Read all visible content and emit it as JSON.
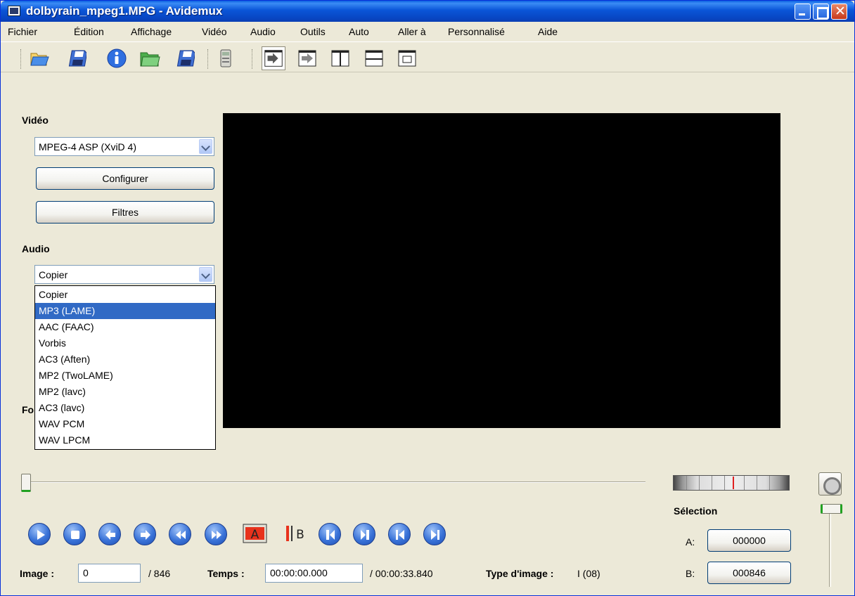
{
  "window": {
    "title": "dolbyrain_mpeg1.MPG - Avidemux"
  },
  "menu": [
    "Fichier",
    "Édition",
    "Affichage",
    "Vidéo",
    "Audio",
    "Outils",
    "Auto",
    "Aller à",
    "Personnalisé",
    "Aide"
  ],
  "toolbar": {
    "icons": [
      "open-icon",
      "save-icon",
      "info-icon",
      "open-folder-icon",
      "save-copy-icon",
      "calculator-icon",
      "input-preview-icon",
      "output-preview-icon",
      "side-by-side-icon",
      "top-bottom-icon",
      "separate-window-icon"
    ]
  },
  "video_section": {
    "label": "Vidéo",
    "codec": "MPEG-4 ASP (XviD 4)",
    "configure_label": "Configurer",
    "filters_label": "Filtres"
  },
  "audio_section": {
    "label": "Audio",
    "codec": "Copier",
    "options": [
      "Copier",
      "MP3 (LAME)",
      "AAC (FAAC)",
      "Vorbis",
      "AC3 (Aften)",
      "MP2 (TwoLAME)",
      "MP2 (lavc)",
      "AC3 (lavc)",
      "WAV PCM",
      "WAV LPCM"
    ],
    "highlighted": "MP3 (LAME)"
  },
  "format_label_partial": "Fo",
  "playback": {
    "buttons": [
      "play",
      "stop",
      "previous-frame",
      "next-frame",
      "previous-keyframe",
      "next-keyframe",
      "set-marker-a",
      "set-marker-b",
      "go-to-marker-a",
      "go-to-marker-b",
      "previous-black-frame",
      "next-black-frame"
    ]
  },
  "status": {
    "image_label": "Image :",
    "image_value": "0",
    "image_total": "/ 846",
    "time_label": "Temps :",
    "time_value": "00:00:00.000",
    "time_total": "/ 00:00:33.840",
    "frame_type_label": "Type d'image :",
    "frame_type_value": "I (08)"
  },
  "selection": {
    "label": "Sélection",
    "a_label": "A:",
    "a_value": "000000",
    "b_label": "B:",
    "b_value": "000846"
  },
  "colors": {
    "title_bar": "#0a55d8",
    "face": "#ece9d8",
    "selection": "#316ac5",
    "video_bg": "#000000"
  }
}
